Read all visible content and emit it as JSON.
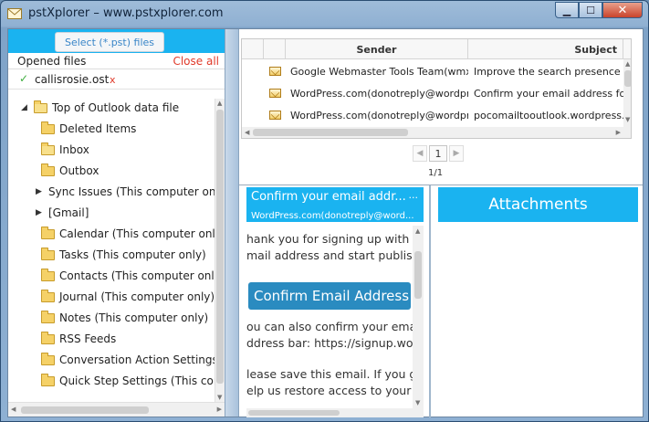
{
  "window": {
    "title": "pstXplorer – www.pstxplorer.com",
    "controls": {
      "minimize": "▁",
      "maximize": "☐",
      "close": "✕"
    }
  },
  "left_panel": {
    "select_button": "Select (*.pst) files",
    "opened_label": "Opened files",
    "close_all": "Close all",
    "file": {
      "name": "callisrosie.ost",
      "remove": "x"
    },
    "tree": [
      {
        "label": "Top of Outlook data file",
        "indent": 0,
        "arrow": "◢",
        "icon": "folder-open-icon"
      },
      {
        "label": "Deleted Items",
        "indent": 1,
        "arrow": "",
        "icon": "folder-icon"
      },
      {
        "label": "Inbox",
        "indent": 1,
        "arrow": "",
        "icon": "folder-open-icon"
      },
      {
        "label": "Outbox",
        "indent": 1,
        "arrow": "",
        "icon": "folder-icon"
      },
      {
        "label": "Sync Issues (This computer only)",
        "indent": 1,
        "arrow": "▶",
        "icon": ""
      },
      {
        "label": "[Gmail]",
        "indent": 1,
        "arrow": "▶",
        "icon": ""
      },
      {
        "label": "Calendar (This computer only)",
        "indent": 1,
        "arrow": "",
        "icon": "folder-icon"
      },
      {
        "label": "Tasks (This computer only)",
        "indent": 1,
        "arrow": "",
        "icon": "folder-icon"
      },
      {
        "label": "Contacts (This computer only)",
        "indent": 1,
        "arrow": "",
        "icon": "folder-icon"
      },
      {
        "label": "Journal (This computer only)",
        "indent": 1,
        "arrow": "",
        "icon": "folder-icon"
      },
      {
        "label": "Notes (This computer only)",
        "indent": 1,
        "arrow": "",
        "icon": "folder-icon"
      },
      {
        "label": "RSS Feeds",
        "indent": 1,
        "arrow": "",
        "icon": "folder-icon"
      },
      {
        "label": "Conversation Action Settings (T",
        "indent": 1,
        "arrow": "",
        "icon": "folder-icon"
      },
      {
        "label": "Quick Step Settings (This comp",
        "indent": 1,
        "arrow": "",
        "icon": "folder-icon"
      }
    ]
  },
  "message_list": {
    "columns": {
      "sender": "Sender",
      "subject": "Subject"
    },
    "rows": [
      {
        "sender": "Google Webmaster Tools Team(wmx-...",
        "subject": "Improve the search presence of h"
      },
      {
        "sender": "WordPress.com(donotreply@wordpre...",
        "subject": "Confirm your email address for p"
      },
      {
        "sender": "WordPress.com(donotreply@wordpre...",
        "subject": "pocomailtooutlook.wordpress.com"
      }
    ]
  },
  "pager": {
    "prev": "◀",
    "current": "1",
    "next": "▶",
    "count": "1/1"
  },
  "email": {
    "subject": "Confirm your email addr...",
    "more": "...",
    "from": "WordPress.com(donotreply@word...",
    "body_lines": [
      "hank you for signing up with W",
      "mail address and start publish",
      "ou can also confirm your ema",
      "ddress bar: https://signup.wor",
      "lease save this email. If you g",
      "elp us restore access to your"
    ],
    "button": "Confirm Email Address"
  },
  "attachments": {
    "title": "Attachments"
  },
  "colors": {
    "accent": "#1ab3f0",
    "close_all": "#e03a2a",
    "confirm_button": "#2a8bc0"
  }
}
